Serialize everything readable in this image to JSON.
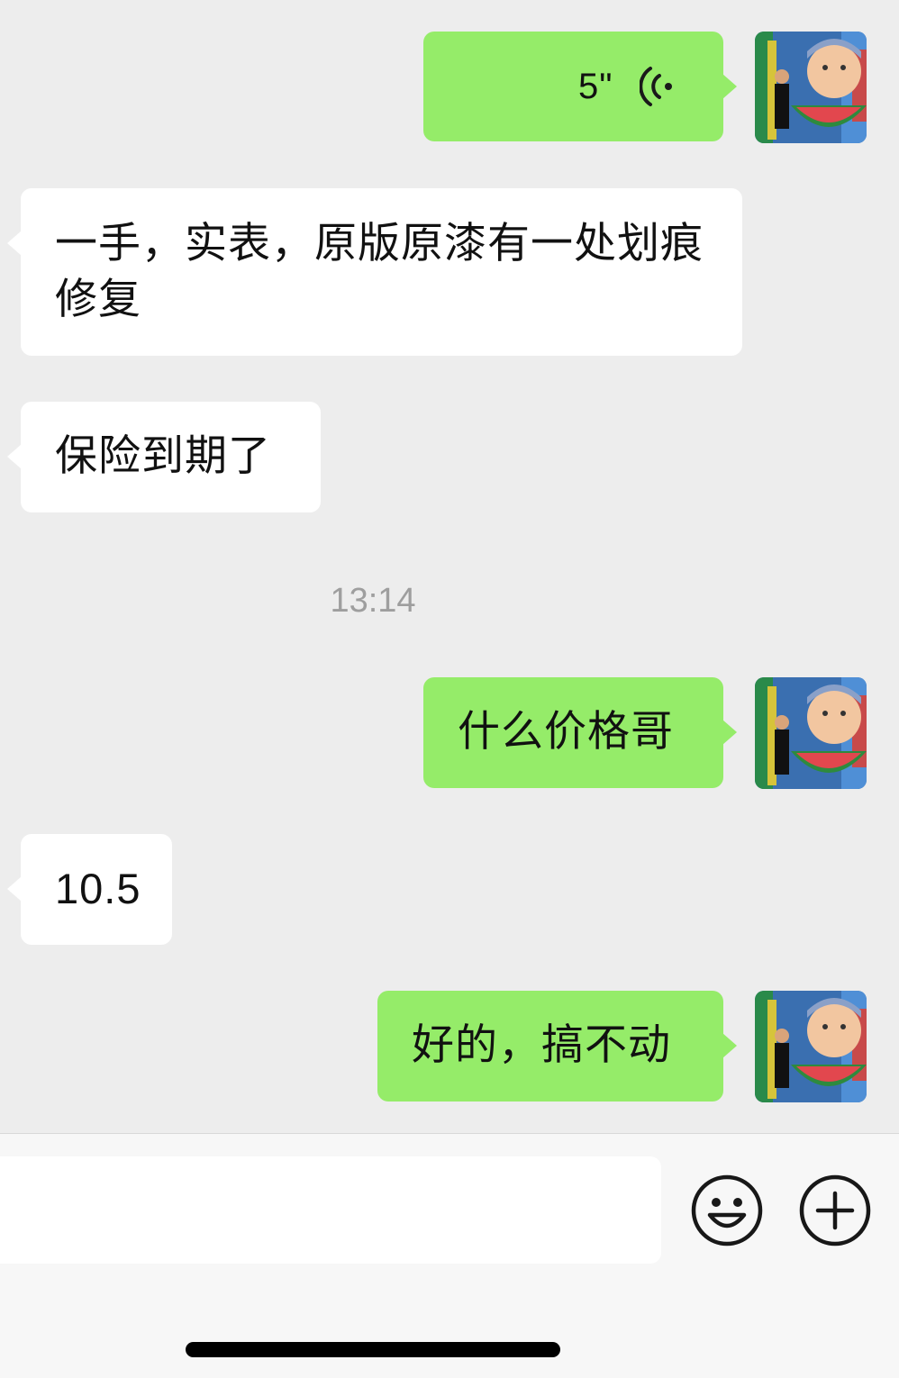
{
  "messages": [
    {
      "from": "me",
      "type": "voice",
      "duration": "5\""
    },
    {
      "from": "them",
      "type": "text",
      "text": "一手，实表，原版原漆有一处划痕修复"
    },
    {
      "from": "them",
      "type": "text",
      "text": "保险到期了"
    },
    {
      "from": "system",
      "type": "timestamp",
      "text": "13:14"
    },
    {
      "from": "me",
      "type": "text",
      "text": "什么价格哥"
    },
    {
      "from": "them",
      "type": "text",
      "text": "10.5"
    },
    {
      "from": "me",
      "type": "text",
      "text": "好的，搞不动"
    }
  ],
  "colors": {
    "background": "#ededed",
    "my_bubble": "#95ec69",
    "their_bubble": "#ffffff",
    "timestamp_text": "#9e9e9e"
  },
  "icons": {
    "voice": "voice-wave-icon",
    "emoji": "smiley-face-icon",
    "more": "plus-circle-icon"
  }
}
